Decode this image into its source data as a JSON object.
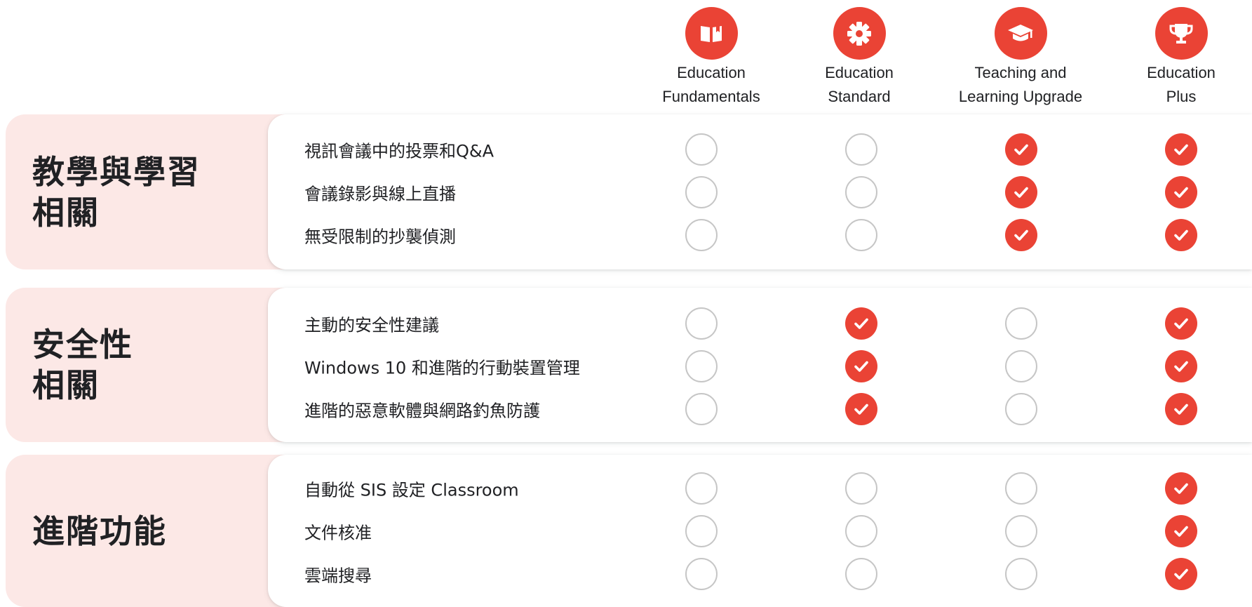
{
  "colors": {
    "accent": "#ea4335",
    "section_bg": "#fce8e6",
    "empty_ring": "#c6c6c6",
    "text": "#202124"
  },
  "columns": [
    {
      "id": "fundamentals",
      "icon": "book-icon",
      "label": "Education\nFundamentals"
    },
    {
      "id": "standard",
      "icon": "gear-icon",
      "label": "Education\nStandard"
    },
    {
      "id": "tlu",
      "icon": "graduation-cap-icon",
      "label": "Teaching and\nLearning Upgrade"
    },
    {
      "id": "plus",
      "icon": "trophy-icon",
      "label": "Education\nPlus"
    }
  ],
  "sections": [
    {
      "title": "教學與學習\n相關",
      "features": [
        {
          "label": "視訊會議中的投票和Q&A",
          "included": [
            false,
            false,
            true,
            true
          ]
        },
        {
          "label": "會議錄影與線上直播",
          "included": [
            false,
            false,
            true,
            true
          ]
        },
        {
          "label": "無受限制的抄襲偵測",
          "included": [
            false,
            false,
            true,
            true
          ]
        }
      ]
    },
    {
      "title": "安全性\n相關",
      "features": [
        {
          "label": "主動的安全性建議",
          "included": [
            false,
            true,
            false,
            true
          ]
        },
        {
          "label": "Windows 10 和進階的行動裝置管理",
          "included": [
            false,
            true,
            false,
            true
          ]
        },
        {
          "label": "進階的惡意軟體與網路釣魚防護",
          "included": [
            false,
            true,
            false,
            true
          ]
        }
      ]
    },
    {
      "title": "進階功能",
      "features": [
        {
          "label": "自動從 SIS 設定 Classroom",
          "included": [
            false,
            false,
            false,
            true
          ]
        },
        {
          "label": "文件核准",
          "included": [
            false,
            false,
            false,
            true
          ]
        },
        {
          "label": "雲端搜尋",
          "included": [
            false,
            false,
            false,
            true
          ]
        }
      ]
    }
  ]
}
